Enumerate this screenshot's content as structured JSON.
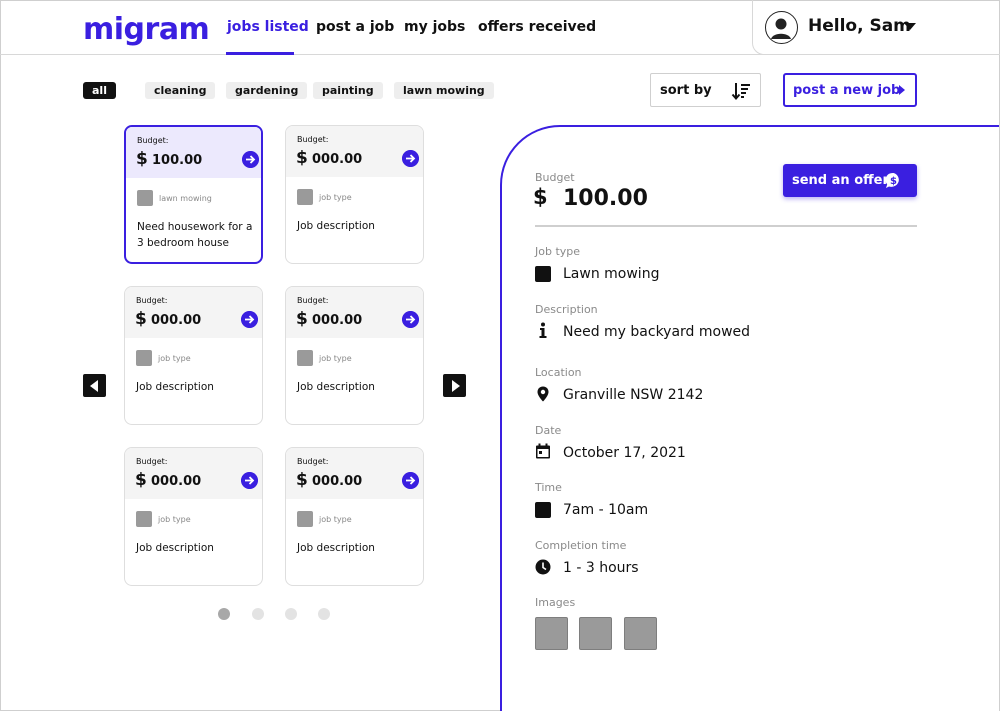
{
  "brand": {
    "logo_text": "migram",
    "accent_color": "#3a1fe0"
  },
  "nav": {
    "items": [
      {
        "label": "jobs listed",
        "active": true
      },
      {
        "label": "post a job",
        "active": false
      },
      {
        "label": "my jobs",
        "active": false
      },
      {
        "label": "offers received",
        "active": false
      }
    ]
  },
  "user": {
    "greeting": "Hello, Sam",
    "icon": "user-avatar-icon"
  },
  "filters": {
    "chips": [
      {
        "label": "all",
        "active": true
      },
      {
        "label": "cleaning",
        "active": false
      },
      {
        "label": "gardening",
        "active": false
      },
      {
        "label": "painting",
        "active": false
      },
      {
        "label": "lawn mowing",
        "active": false
      }
    ]
  },
  "toolbar": {
    "sort_label": "sort by",
    "sort_icon": "sort-descending-icon",
    "post_label": "post a new job"
  },
  "cards": [
    {
      "budget_label": "Budget:",
      "currency": "$",
      "amount": "100.00",
      "type": "lawn mowing",
      "description": "Need housework for a 3 bedroom house",
      "selected": true
    },
    {
      "budget_label": "Budget:",
      "currency": "$",
      "amount": "000.00",
      "type": "job type",
      "description": "Job description",
      "selected": false
    },
    {
      "budget_label": "Budget:",
      "currency": "$",
      "amount": "000.00",
      "type": "job type",
      "description": "Job description",
      "selected": false
    },
    {
      "budget_label": "Budget:",
      "currency": "$",
      "amount": "000.00",
      "type": "job type",
      "description": "Job description",
      "selected": false
    },
    {
      "budget_label": "Budget:",
      "currency": "$",
      "amount": "000.00",
      "type": "job type",
      "description": "Job description",
      "selected": false
    },
    {
      "budget_label": "Budget:",
      "currency": "$",
      "amount": "000.00",
      "type": "job type",
      "description": "Job description",
      "selected": false
    }
  ],
  "pagination": {
    "pages": 4,
    "current": 1
  },
  "detail": {
    "budget_label": "Budget",
    "currency": "$",
    "amount": "100.00",
    "offer_label": "send an offer",
    "job_type_label": "Job type",
    "job_type_value": "Lawn mowing",
    "description_label": "Description",
    "description_value": "Need my backyard mowed",
    "location_label": "Location",
    "location_value": "Granville NSW 2142",
    "date_label": "Date",
    "date_value": "October 17, 2021",
    "time_label": "Time",
    "time_value": "7am - 10am",
    "completion_label": "Completion time",
    "completion_value": "1 - 3 hours",
    "images_label": "Images",
    "images_count": 3
  }
}
